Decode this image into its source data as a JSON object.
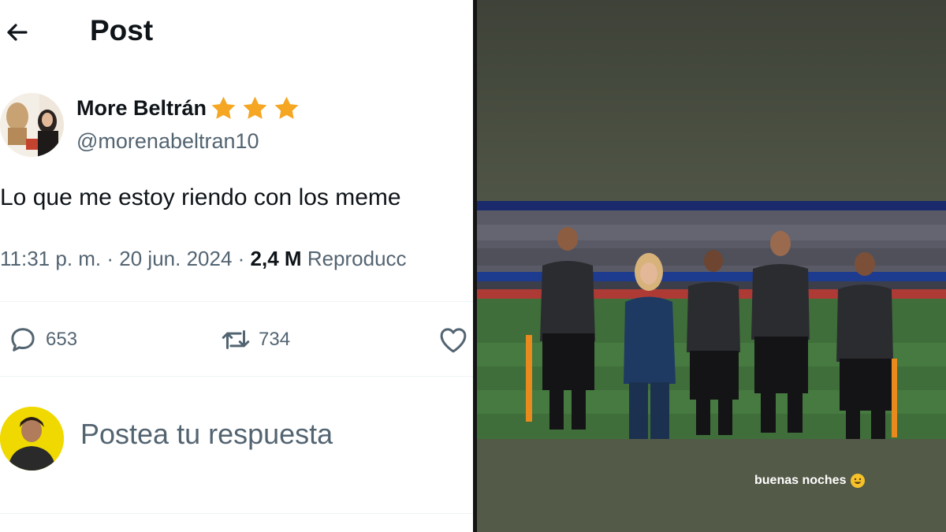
{
  "header": {
    "title": "Post"
  },
  "post": {
    "author_name": "More Beltrán",
    "author_handle": "@morenabeltran10",
    "star_count": 3,
    "text": "Lo que me estoy riendo con los meme",
    "time": "11:31 p. m.",
    "separator": "·",
    "date": "20 jun. 2024",
    "views": "2,4 M",
    "views_label": "Reproducc"
  },
  "actions": {
    "replies": "653",
    "reposts": "734"
  },
  "reply_box": {
    "placeholder": "Postea tu respuesta"
  },
  "story": {
    "caption": "buenas noches"
  },
  "colors": {
    "text_primary": "#0f1419",
    "text_secondary": "#536471",
    "star": "#f5a623",
    "story_bg": "#4d5344",
    "pitch": "#3f6e3a"
  }
}
